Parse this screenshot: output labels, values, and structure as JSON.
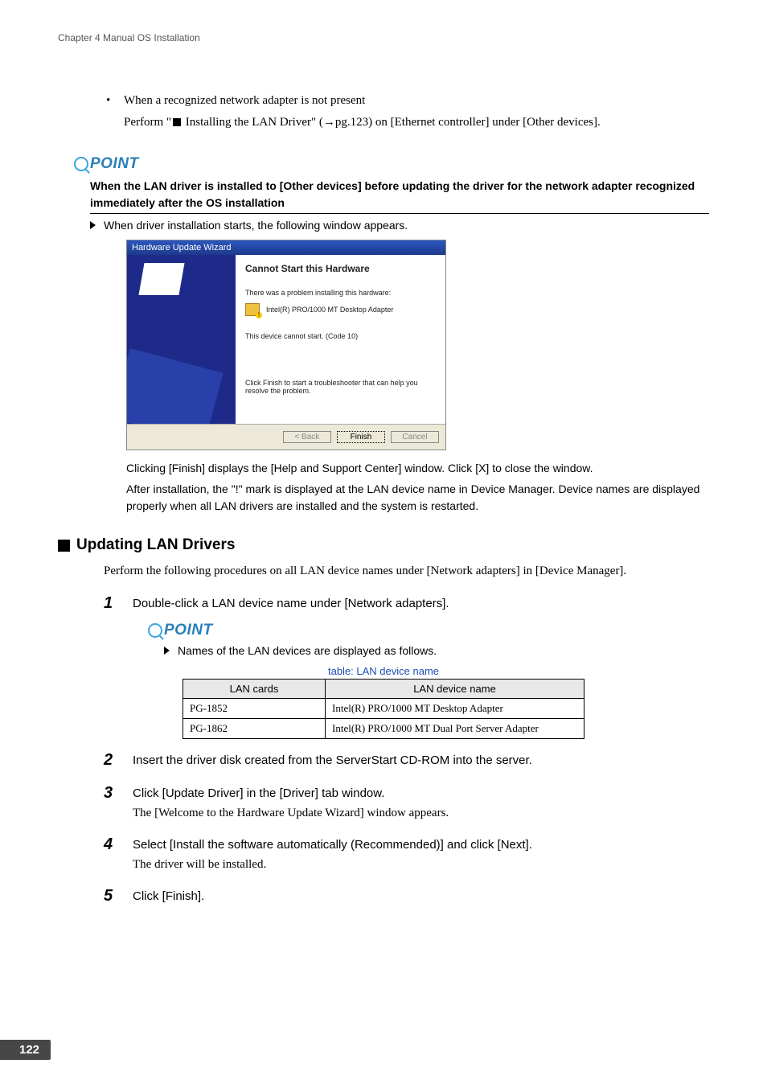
{
  "chapter_header": "Chapter 4  Manual OS Installation",
  "prereq": {
    "bullet_glyph": "•",
    "line1": "When a recognized network adapter is not present",
    "line2a": "Perform \"",
    "line2b": " Installing the LAN Driver\" (",
    "line2_arrow": "→",
    "line2c": "pg.123) on [Ethernet controller] under [Other devices]."
  },
  "point_label": "POINT",
  "point_title": "When the LAN driver is installed to [Other devices] before updating the driver for the network adapter recognized immediately after the OS installation",
  "point_bullet": "When driver installation starts, the following window appears.",
  "dialog": {
    "titlebar": "Hardware Update Wizard",
    "heading": "Cannot Start this Hardware",
    "line1": "There was a problem installing this hardware:",
    "device": "Intel(R) PRO/1000 MT Desktop Adapter",
    "line2": "This device cannot start. (Code 10)",
    "line3": "Click Finish to start a troubleshooter that can help you resolve the problem.",
    "btn_back": "< Back",
    "btn_finish": "Finish",
    "btn_cancel": "Cancel"
  },
  "after_dialog": {
    "p1": "Clicking [Finish] displays the [Help and Support Center] window. Click [X] to close the window.",
    "p2": "After installation, the \"!\" mark is displayed at the LAN device name in Device Manager. Device names are displayed properly when all LAN drivers are installed and the system is restarted."
  },
  "section_heading": "Updating LAN Drivers",
  "section_intro": "Perform the following procedures on all LAN device names under [Network adapters] in [Device Manager].",
  "steps": {
    "s1": {
      "num": "1",
      "main": "Double-click a LAN device name under [Network adapters].",
      "point_bullet": "Names of the LAN devices are displayed as follows."
    },
    "s2": {
      "num": "2",
      "main": "Insert the driver disk created from the ServerStart CD-ROM into the server."
    },
    "s3": {
      "num": "3",
      "main": "Click [Update Driver] in the [Driver] tab window.",
      "sub": "The [Welcome to the Hardware Update Wizard] window appears."
    },
    "s4": {
      "num": "4",
      "main": "Select [Install the software automatically (Recommended)] and click [Next].",
      "sub": "The driver will be installed."
    },
    "s5": {
      "num": "5",
      "main": "Click [Finish]."
    }
  },
  "table": {
    "caption": "table: LAN device name",
    "header": {
      "c1": "LAN cards",
      "c2": "LAN device name"
    },
    "rows": [
      {
        "c1": "PG-1852",
        "c2": "Intel(R) PRO/1000 MT Desktop Adapter"
      },
      {
        "c1": "PG-1862",
        "c2": "Intel(R) PRO/1000 MT Dual Port Server Adapter"
      }
    ]
  },
  "page_number": "122"
}
